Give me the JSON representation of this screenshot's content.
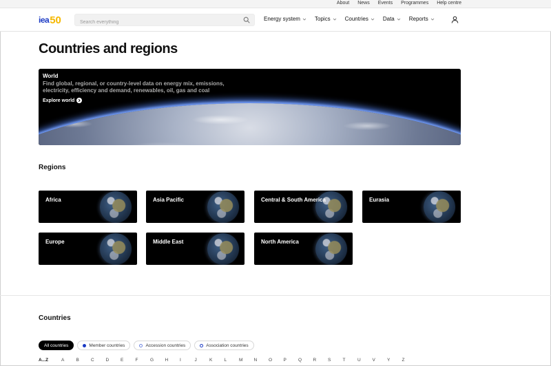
{
  "utility_nav": [
    "About",
    "News",
    "Events",
    "Programmes",
    "Help centre"
  ],
  "logo": {
    "text": "iea",
    "number": "50"
  },
  "search": {
    "placeholder": "Search everything"
  },
  "main_nav": [
    "Energy system",
    "Topics",
    "Countries",
    "Data",
    "Reports"
  ],
  "page": {
    "title": "Countries and regions"
  },
  "hero": {
    "title": "World",
    "description": "Find global, regional, or country-level data on energy mix, emissions, electricity, efficiency and demand, renewables, oil, gas and coal",
    "link_label": "Explore world"
  },
  "regions": {
    "title": "Regions",
    "items": [
      "Africa",
      "Asia Pacific",
      "Central & South America",
      "Eurasia",
      "Europe",
      "Middle East",
      "North America"
    ]
  },
  "countries": {
    "title": "Countries",
    "filters": [
      "All countries",
      "Member countries",
      "Accession countries",
      "Association countries"
    ],
    "active_filter": "All countries",
    "alphabet": [
      "A...Z",
      "A",
      "B",
      "C",
      "D",
      "E",
      "F",
      "G",
      "H",
      "I",
      "J",
      "K",
      "L",
      "M",
      "N",
      "O",
      "P",
      "Q",
      "R",
      "S",
      "T",
      "U",
      "V",
      "Y",
      "Z"
    ]
  },
  "colors": {
    "brand_blue": "#1a39c4",
    "brand_yellow": "#f5b800"
  },
  "icons": {
    "search": "search-icon",
    "user": "user-icon",
    "chevron": "chevron-down-icon",
    "arrow": "arrow-right-circle-icon"
  }
}
